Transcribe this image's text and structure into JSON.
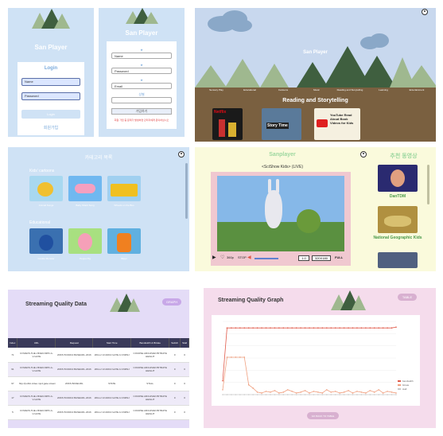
{
  "login": {
    "app_title": "San Player",
    "heading": "Login",
    "username_value": "Name",
    "password_value": "Password",
    "login_button": "Login",
    "signup_link": "회원가입"
  },
  "signup": {
    "app_title": "San Player",
    "name_value": "Name",
    "password_value": "Password",
    "email_value": "Email",
    "gender_label": "성별",
    "confirm_button": "가입하기",
    "notice_text": "회원 가입 중 문제가 발생하면 관리자에게 문의하십시오"
  },
  "home": {
    "app_title": "San Player",
    "nav_labels": [
      "Sensory Play",
      "Educational",
      "Cartoons",
      "Music",
      "Reading and Storytelling",
      "Learning",
      "Entertainment"
    ],
    "section_title": "Reading and Storytelling",
    "videos": [
      "Netflix",
      "Story Time",
      "YouTube Read Aloud Book Videos for Kids"
    ]
  },
  "category": {
    "title": "카테고리 목록",
    "group1_title": "Kids' cartoons",
    "group1_items": [
      "Animal Songs",
      "Baby Shark Song",
      "Wheels on the Bus"
    ],
    "group2_title": "Educational",
    "group2_items": [
      "Cookie Monster",
      "Peppa Pig",
      "Blippi"
    ]
  },
  "player": {
    "app_title": "Sanplayer",
    "video_title": "<SciShow Kids> (LIVE)",
    "sidebar_title": "추천 동영상",
    "recommend_items": [
      "DanTDM",
      "National Geographic Kids"
    ],
    "speed_value": "1.0",
    "resolution_value": "320X180",
    "fullscreen_label": "FULL",
    "stop_label": "STOP",
    "quality_label": "360p"
  },
  "quality_data": {
    "title": "Streaming Quality Data",
    "graph_button": "GRAPH",
    "columns": [
      "Index",
      "URL",
      "Request",
      "Start Time",
      "Bandwidth & Bitrate",
      "Switch",
      "Stall"
    ],
    "rows": [
      [
        "71",
        "COVERS-THE-VIDEO-MPD-A-V-GATE",
        "2DKS 5/3/2013 BASEURL.2016",
        "2011-2 1/1/2013 GATE A CNRNJ",
        "COURSE ARCHIVED BITRATE HEIGHT",
        "0",
        "0"
      ],
      [
        "91",
        "COVERS-THE-VIDEO-MPD-A-V-GATE",
        "2DKS 5/3/2013 BASEURL.2016",
        "2011-2 1/1/2013 GATE A CNRNJ",
        "COURSE ARCHIVED BITRATE HEIGHT",
        "0",
        "0"
      ],
      [
        "97",
        "http://public.video.mpd.gate.stream",
        "2DKS BASEURL",
        "STATE",
        "STALL",
        "0",
        "0"
      ],
      [
        "17",
        "COVERS-THE-VIDEO-MPD-A-V-GATE",
        "2DKS 5/3/2013 BASEURL.2016",
        "2011-2 1/1/2013 GATE A CNRNJ",
        "COURSE ARCHIVED BITRATE HEIGHT",
        "0",
        "0"
      ],
      [
        "5",
        "COVERS-THE-VIDEO-MPD-A-V-GATE",
        "2DKS 5/3/2013 BASEURL.2016",
        "2011-2 1/1/2013 GATE A CNRNJ",
        "COURSE ARCHIVED BITRATE HEIGHT",
        "0",
        "0"
      ]
    ]
  },
  "quality_graph": {
    "title": "Streaming Quality Graph",
    "table_button": "TABLE",
    "back_button": "GO BACK TO TABLE",
    "legend": [
      "bandwidth",
      "bitrate",
      "stall"
    ],
    "colors": {
      "bandwidth": "#e05a4a",
      "bitrate": "#f0a080",
      "stall": "#c8c8c8"
    }
  },
  "chart_data": {
    "type": "line",
    "series": [
      {
        "name": "bandwidth",
        "values": [
          1.7,
          8.2,
          8.2,
          8.2,
          8.2,
          8.2,
          8.2,
          8.2,
          8.2,
          8.2,
          8.2,
          8.2,
          8.2,
          8.2,
          8.2,
          8.2,
          8.2,
          8.2,
          8.2,
          8.2,
          8.2,
          8.2,
          8.2,
          8.2,
          8.2,
          8.2,
          8.2,
          8.2,
          8.2,
          8.2,
          8.2,
          8.2,
          8.2,
          8.2,
          8.2,
          8.2,
          8.2,
          8.2,
          8.2,
          8.2,
          8.3
        ]
      },
      {
        "name": "bitrate",
        "values": [
          0.6,
          4.6,
          4.6,
          4.6,
          4.6,
          4.6,
          1.2,
          0.8,
          0.3,
          0.2,
          0.4,
          0.3,
          0.5,
          0.2,
          0.3,
          0.6,
          0.4,
          0.2,
          0.3,
          0.5,
          0.2,
          0.4,
          0.3,
          0.2,
          0.6,
          0.3,
          0.4,
          0.2,
          0.3,
          0.5,
          0.2,
          0.4,
          0.3,
          0.2,
          0.5,
          0.3,
          0.6,
          0.2,
          0.4,
          0.3,
          0.2
        ]
      },
      {
        "name": "stall",
        "values": [
          0,
          0,
          0,
          0,
          0,
          0,
          0,
          0,
          0,
          0,
          0,
          0,
          0,
          0,
          0,
          0,
          0,
          0,
          0,
          0,
          0,
          0,
          0,
          0,
          0,
          0,
          0,
          0,
          0,
          0,
          0,
          0,
          0,
          0,
          0,
          0,
          0,
          0,
          0,
          0,
          0
        ]
      }
    ],
    "ylim": [
      0,
      9
    ]
  }
}
